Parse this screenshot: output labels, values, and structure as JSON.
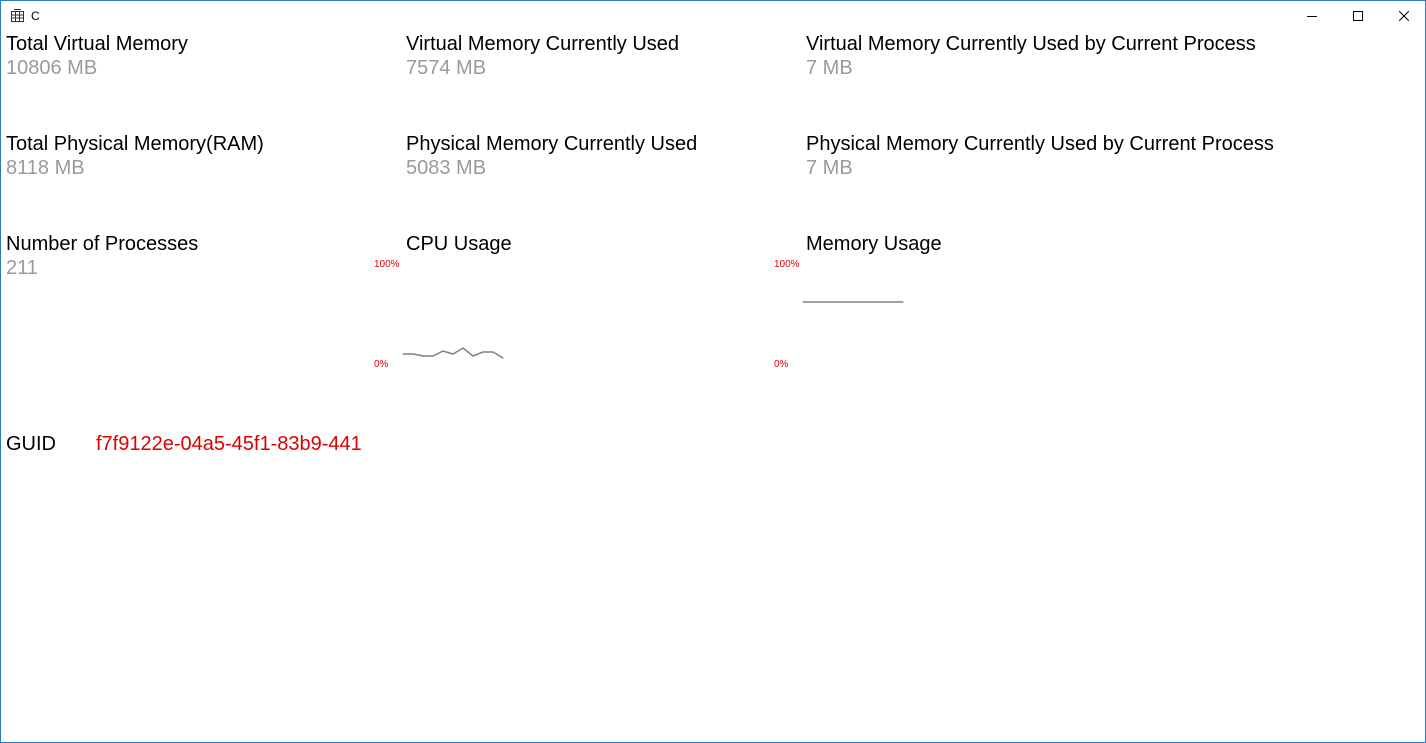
{
  "window": {
    "title": "C",
    "icon": "app-grid-icon",
    "controls": {
      "minimize_icon": "minimize-icon",
      "maximize_icon": "maximize-icon",
      "close_icon": "close-icon"
    }
  },
  "stats": {
    "total_virtual": {
      "label": "Total Virtual Memory",
      "value": "10806 MB"
    },
    "virtual_used": {
      "label": "Virtual Memory Currently Used",
      "value": "7574 MB"
    },
    "virtual_process": {
      "label": "Virtual Memory Currently Used by Current Process",
      "value": "7 MB"
    },
    "total_physical": {
      "label": "Total Physical Memory(RAM)",
      "value": "8118 MB"
    },
    "physical_used": {
      "label": "Physical Memory Currently Used",
      "value": "5083 MB"
    },
    "physical_process": {
      "label": "Physical Memory Currently Used by Current Process",
      "value": "7 MB"
    },
    "processes": {
      "label": "Number of Processes",
      "value": "211"
    }
  },
  "cpu": {
    "label": "CPU Usage",
    "axis_max": "100%",
    "axis_min": "0%",
    "line_color": "#808080",
    "values": [
      10,
      10,
      8,
      8,
      13,
      10,
      16,
      8,
      12,
      12,
      6
    ]
  },
  "memory": {
    "label": "Memory Usage",
    "axis_max": "100%",
    "axis_min": "0%",
    "line_color": "#808080",
    "values": [
      62,
      62,
      62,
      62,
      62,
      62,
      62,
      62,
      62,
      62,
      62
    ]
  },
  "guid": {
    "label": "GUID",
    "value": "f7f9122e-04a5-45f1-83b9-441",
    "color": "#e00000"
  }
}
